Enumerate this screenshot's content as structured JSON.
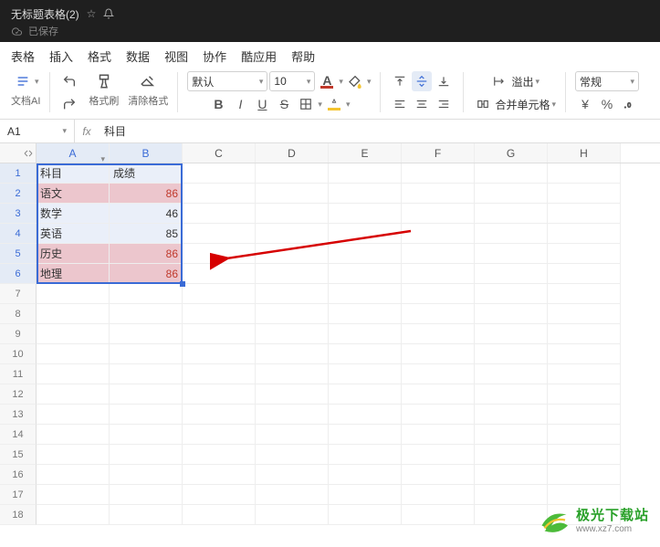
{
  "title": "无标题表格(2)",
  "saved_label": "已保存",
  "menu": [
    "表格",
    "插入",
    "格式",
    "数据",
    "视图",
    "协作",
    "酷应用",
    "帮助"
  ],
  "toolbar": {
    "doc_ai": "文档AI",
    "format_painter": "格式刷",
    "clear_format": "清除格式",
    "font_name": "默认",
    "font_size": "10",
    "overflow": "溢出",
    "merge_cells": "合并单元格",
    "number_format": "常规"
  },
  "namebox": "A1",
  "formula": "科目",
  "columns": [
    "A",
    "B",
    "C",
    "D",
    "E",
    "F",
    "G",
    "H"
  ],
  "rows_visible": 18,
  "chart_data": {
    "type": "table",
    "headers": [
      "科目",
      "成绩"
    ],
    "rows": [
      {
        "subject": "语文",
        "score": 86,
        "highlight": true
      },
      {
        "subject": "数学",
        "score": 46,
        "highlight": false
      },
      {
        "subject": "英语",
        "score": 85,
        "highlight": false
      },
      {
        "subject": "历史",
        "score": 86,
        "highlight": true
      },
      {
        "subject": "地理",
        "score": 86,
        "highlight": true
      }
    ]
  },
  "watermark": {
    "name": "极光下载站",
    "url": "www.xz7.com"
  }
}
